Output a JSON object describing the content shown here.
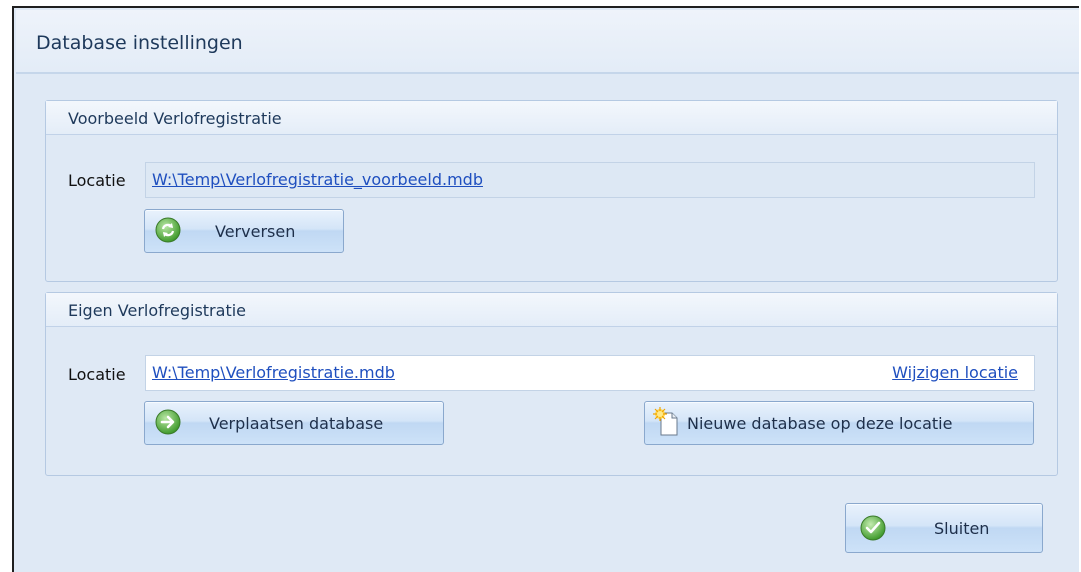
{
  "window": {
    "title": "Database instellingen"
  },
  "example_group": {
    "title": "Voorbeeld Verlofregistratie",
    "location_label": "Locatie",
    "location_value": "W:\\Temp\\Verlofregistratie_voorbeeld.mdb",
    "refresh_button": {
      "label": "Verversen",
      "icon": "refresh-icon"
    }
  },
  "own_group": {
    "title": "Eigen Verlofregistratie",
    "location_label": "Locatie",
    "location_value": "W:\\Temp\\Verlofregistratie.mdb",
    "change_location_link": "Wijzigen locatie",
    "move_button": {
      "label": "Verplaatsen database",
      "icon": "arrow-right-icon"
    },
    "new_button": {
      "label": "Nieuwe database op deze locatie",
      "icon": "new-document-icon"
    }
  },
  "footer": {
    "close_button": {
      "label": "Sluiten",
      "icon": "checkmark-icon"
    }
  },
  "colors": {
    "accent_green": "#4caf3a",
    "link_blue": "#1f4fbf",
    "panel_blue": "#dfe9f5"
  }
}
